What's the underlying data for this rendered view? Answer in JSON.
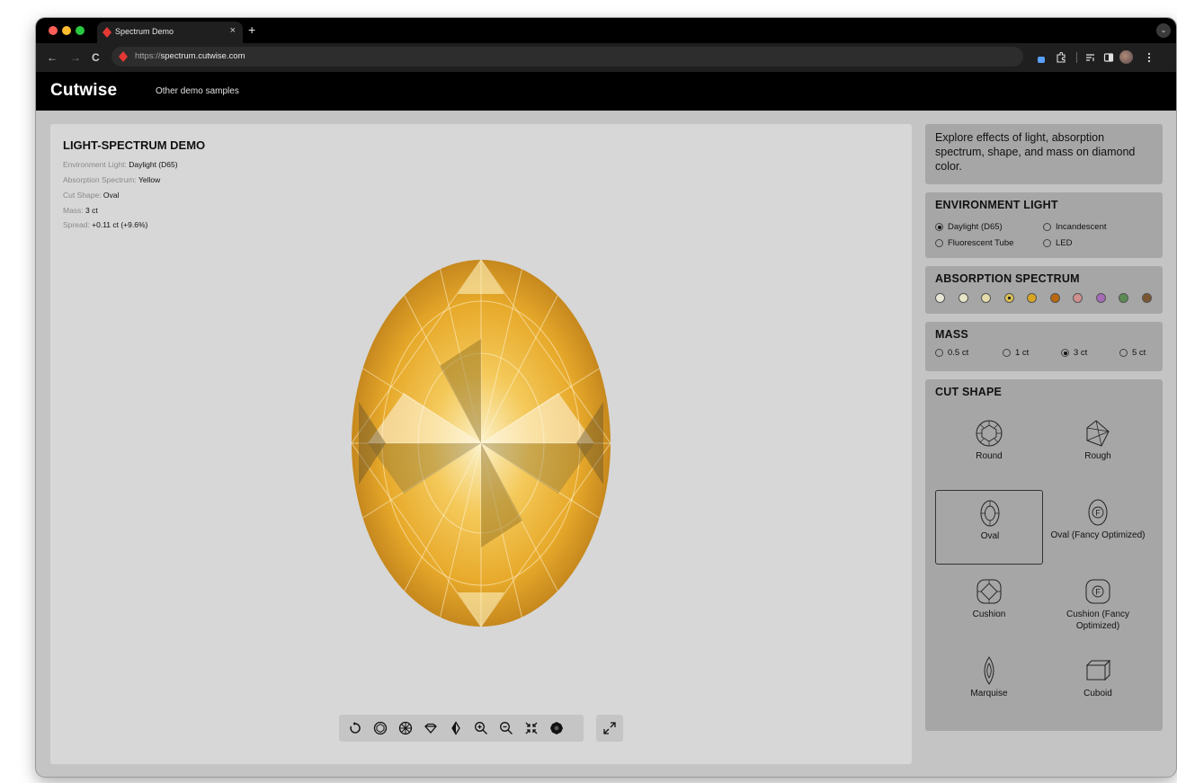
{
  "browser": {
    "tab_title": "Spectrum Demo",
    "tab_close": "×",
    "new_tab": "+",
    "tab_dropdown": "⌄",
    "url_scheme": "https://",
    "url_host": "spectrum.cutwise.com",
    "back": "←",
    "forward": "→",
    "reload": "C"
  },
  "site": {
    "logo": "Cutwise",
    "nav_link": "Other demo samples"
  },
  "viewer": {
    "title": "LIGHT-SPECTRUM DEMO",
    "info": [
      {
        "label": "Environment Light: ",
        "value": "Daylight (D65)"
      },
      {
        "label": "Absorption Spectrum: ",
        "value": "Yellow"
      },
      {
        "label": "Cut Shape: ",
        "value": "Oval"
      },
      {
        "label": "Mass: ",
        "value": "3 ct"
      },
      {
        "label": "Spread: ",
        "value": "+0.11 ct (+9.6%)"
      }
    ],
    "controls": [
      "rotate-icon",
      "top-view-icon",
      "bottom-view-icon",
      "side-view-icon",
      "half-view-icon",
      "zoom-in-icon",
      "zoom-out-icon",
      "fit-icon",
      "gem-render-icon"
    ],
    "fullscreen": "expand-icon"
  },
  "sidebar": {
    "description": "Explore effects of light, absorption spectrum, shape, and mass on diamond color.",
    "environment_light": {
      "title": "ENVIRONMENT LIGHT",
      "options": [
        "Daylight (D65)",
        "Incandescent",
        "Fluorescent Tube",
        "LED"
      ],
      "selected": "Daylight (D65)"
    },
    "absorption_spectrum": {
      "title": "ABSORPTION SPECTRUM",
      "swatches": [
        "#e8e6d6",
        "#e6e5c8",
        "#e3dbaa",
        "#d9bf55",
        "#d9a520",
        "#b8670e",
        "#d28f8f",
        "#a56bb5",
        "#5b8a52",
        "#7a5730"
      ],
      "selected_index": 3
    },
    "mass": {
      "title": "MASS",
      "options": [
        "0.5 ct",
        "1 ct",
        "3 ct",
        "5 ct"
      ],
      "selected": "3 ct"
    },
    "cut_shape": {
      "title": "CUT SHAPE",
      "shapes": [
        "Round",
        "Rough",
        "Oval",
        "Oval (Fancy Optimized)",
        "Cushion",
        "Cushion (Fancy Optimized)",
        "Marquise",
        "Cuboid"
      ],
      "selected": "Oval"
    }
  }
}
